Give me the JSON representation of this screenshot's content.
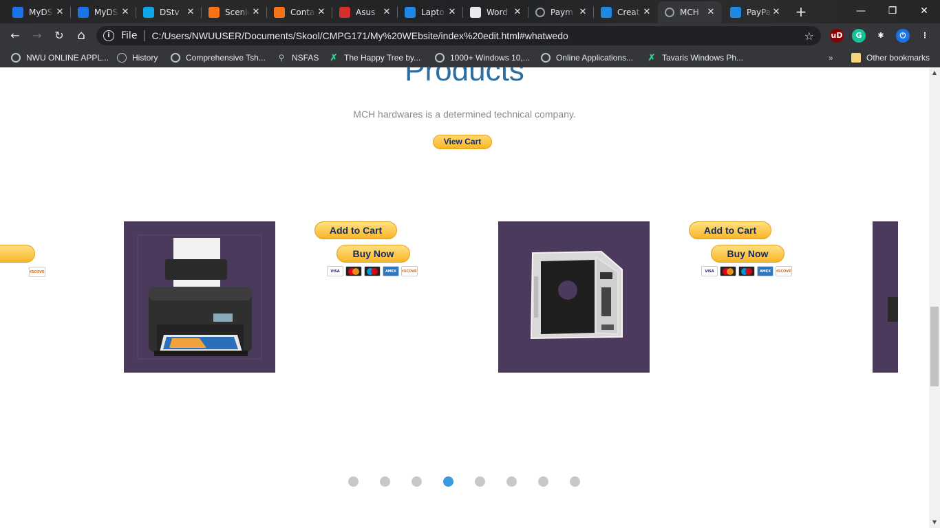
{
  "browser": {
    "tabs": [
      {
        "title": "MyDS",
        "icon": "myds-icon",
        "color": "#1a73e8"
      },
      {
        "title": "MyDS",
        "icon": "myds-icon",
        "color": "#1a73e8"
      },
      {
        "title": "DStv",
        "icon": "dstv-play-icon",
        "color": "#0ea5e9"
      },
      {
        "title": "Scenic",
        "icon": "t-logo-icon",
        "color": "#f97316"
      },
      {
        "title": "Conta",
        "icon": "t-logo-icon",
        "color": "#f97316"
      },
      {
        "title": "Asus",
        "icon": "m-logo-icon",
        "color": "#d32f2f"
      },
      {
        "title": "Lapto",
        "icon": "flag-icon",
        "color": "#1e88e5"
      },
      {
        "title": "Word",
        "icon": "wordpress-icon",
        "color": "#e8eaed"
      },
      {
        "title": "Paym",
        "icon": "globe-icon",
        "color": "#9aa0a6"
      },
      {
        "title": "Creat",
        "icon": "paypal-icon",
        "color": "#1e88e5"
      },
      {
        "title": "MCH",
        "icon": "globe-icon",
        "color": "#9aa0a6",
        "active": true
      },
      {
        "title": "PayPa",
        "icon": "paypal-icon",
        "color": "#1e88e5"
      }
    ],
    "new_tab": "+",
    "window": {
      "minimize": "—",
      "maximize": "❐",
      "close": "✕"
    },
    "nav": {
      "back": "←",
      "forward": "→",
      "reload": "↻",
      "home": "⌂"
    },
    "address": {
      "scheme_label": "File",
      "url": "C:/Users/NWUUSER/Documents/Skool/CMPG171/My%20WEbsite/index%20edit.html#whatwedo"
    },
    "extensions": [
      {
        "name": "ublock-icon",
        "label": "uD",
        "badge": "1",
        "color": "#8b0000"
      },
      {
        "name": "grammarly-icon",
        "label": "G",
        "color": "#15c39a"
      },
      {
        "name": "extensions-puzzle-icon",
        "label": "✱",
        "color": "#35363a"
      },
      {
        "name": "power-icon",
        "label": "⏻",
        "color": "#1a73e8"
      },
      {
        "name": "menu-icon",
        "label": "⋮",
        "color": "#35363a"
      }
    ],
    "bookmarks": [
      {
        "label": "NWU ONLINE APPL...",
        "icon": "globe"
      },
      {
        "label": "History",
        "icon": "hist"
      },
      {
        "label": "Comprehensive Tsh...",
        "icon": "globe"
      },
      {
        "label": "NSFAS",
        "icon": "nsfas"
      },
      {
        "label": "The Happy Tree by...",
        "icon": "green"
      },
      {
        "label": "1000+ Windows 10,...",
        "icon": "globe"
      },
      {
        "label": "Online Applications...",
        "icon": "globe"
      },
      {
        "label": "Tavaris Windows Ph...",
        "icon": "green"
      }
    ],
    "bookmarks_overflow": "»",
    "other_bookmarks": "Other bookmarks"
  },
  "page": {
    "heading": "Products",
    "tagline": "MCH hardwares is a determined technical company.",
    "view_cart": "View Cart",
    "add_to_cart": "Add to Cart",
    "buy_now": "Buy Now",
    "card_labels": [
      "VISA",
      "",
      "",
      "AMEX",
      "DISCOVER"
    ],
    "products": [
      {
        "name": "printer",
        "image": "printer-image"
      },
      {
        "name": "hdd-caddy",
        "image": "hdd-caddy-image"
      }
    ],
    "carousel": {
      "count": 8,
      "active_index": 3
    }
  }
}
